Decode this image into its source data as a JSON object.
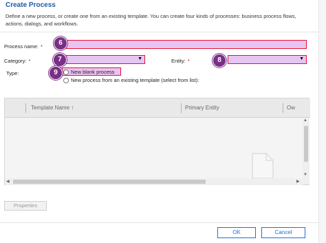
{
  "dialog": {
    "title": "Create Process",
    "description": "Define a new process, or create one from an existing template. You can create four kinds of processes: business process flows, actions, dialogs, and workflows."
  },
  "form": {
    "process_name_label": "Process name:",
    "category_label": "Category:",
    "entity_label": "Entity:",
    "type_label": "Type:",
    "required_mark": "*",
    "process_name_value": "",
    "category_value": "",
    "entity_value": ""
  },
  "type_options": [
    {
      "label": "New blank process",
      "selected": false
    },
    {
      "label": "New process from an existing template (select from list):",
      "selected": false
    }
  ],
  "callouts": [
    "6",
    "7",
    "8",
    "9"
  ],
  "grid": {
    "columns": [
      "Template Name",
      "Primary Entity",
      "Ow"
    ],
    "sort_indicator": "↑"
  },
  "buttons": {
    "properties": "Properties",
    "ok": "OK",
    "cancel": "Cancel"
  },
  "colors": {
    "highlight_border": "#e8112d",
    "highlight_fill": "#e7c4f2",
    "callout": "#7a2f86",
    "accent": "#1f6fd1"
  }
}
